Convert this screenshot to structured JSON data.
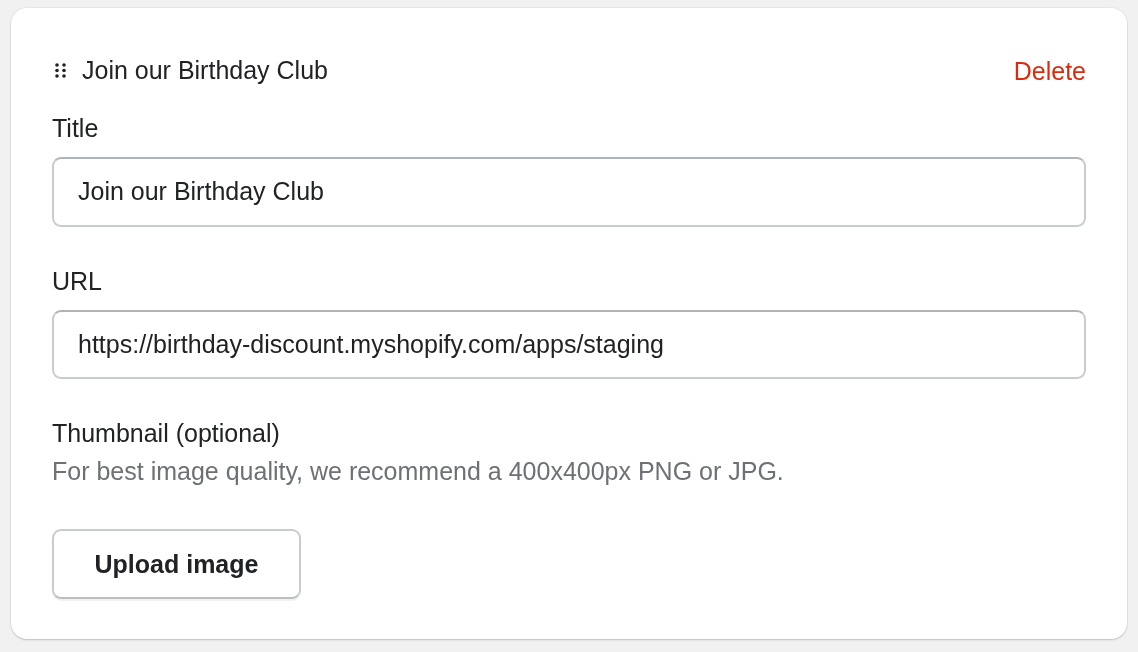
{
  "card": {
    "heading": "Join our Birthday Club",
    "delete_action": "Delete"
  },
  "fields": [
    {
      "label": "Title",
      "value": "Join our Birthday Club"
    },
    {
      "label": "URL",
      "value": "https://birthday-discount.myshopify.com/apps/staging"
    }
  ],
  "thumbnail": {
    "label": "Thumbnail (optional)",
    "help_text": "For best image quality, we recommend a 400x400px PNG or JPG.",
    "button": "Upload image"
  }
}
